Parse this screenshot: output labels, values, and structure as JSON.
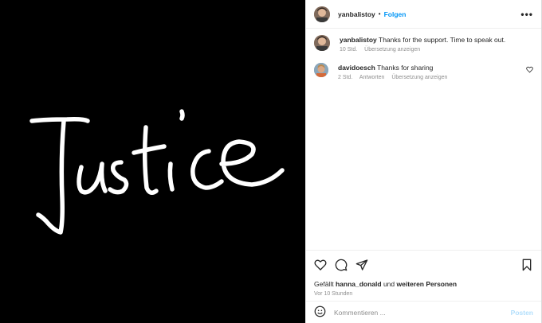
{
  "media": {
    "handwritten_text": "Justice",
    "background": "#000000",
    "ink": "#ffffff"
  },
  "header": {
    "username": "yanbalistoy",
    "separator": "•",
    "follow_label": "Folgen",
    "more_icon": "more-horizontal-icon"
  },
  "comments": [
    {
      "username": "yanbalistoy",
      "text": "Thanks for the support. Time to speak out.",
      "time": "10 Std.",
      "translate": "Übersetzung anzeigen"
    },
    {
      "username": "davidoesch",
      "text": "Thanks for sharing",
      "time": "2 Std.",
      "reply": "Antworten",
      "translate": "Übersetzung anzeigen"
    }
  ],
  "actions": {
    "like_icon": "heart-icon",
    "comment_icon": "comment-icon",
    "share_icon": "share-icon",
    "save_icon": "bookmark-icon",
    "liked_prefix": "Gefällt",
    "liked_user": "hanna_donald",
    "liked_middle": "und",
    "liked_others": "weiteren Personen",
    "time_ago": "Vor 10 Stunden"
  },
  "composer": {
    "emoji_icon": "emoji-icon",
    "placeholder": "Kommentieren ...",
    "post_label": "Posten"
  },
  "colors": {
    "accent": "#0095f6",
    "muted": "#8e8e8e",
    "post_disabled": "#b2dffc"
  }
}
